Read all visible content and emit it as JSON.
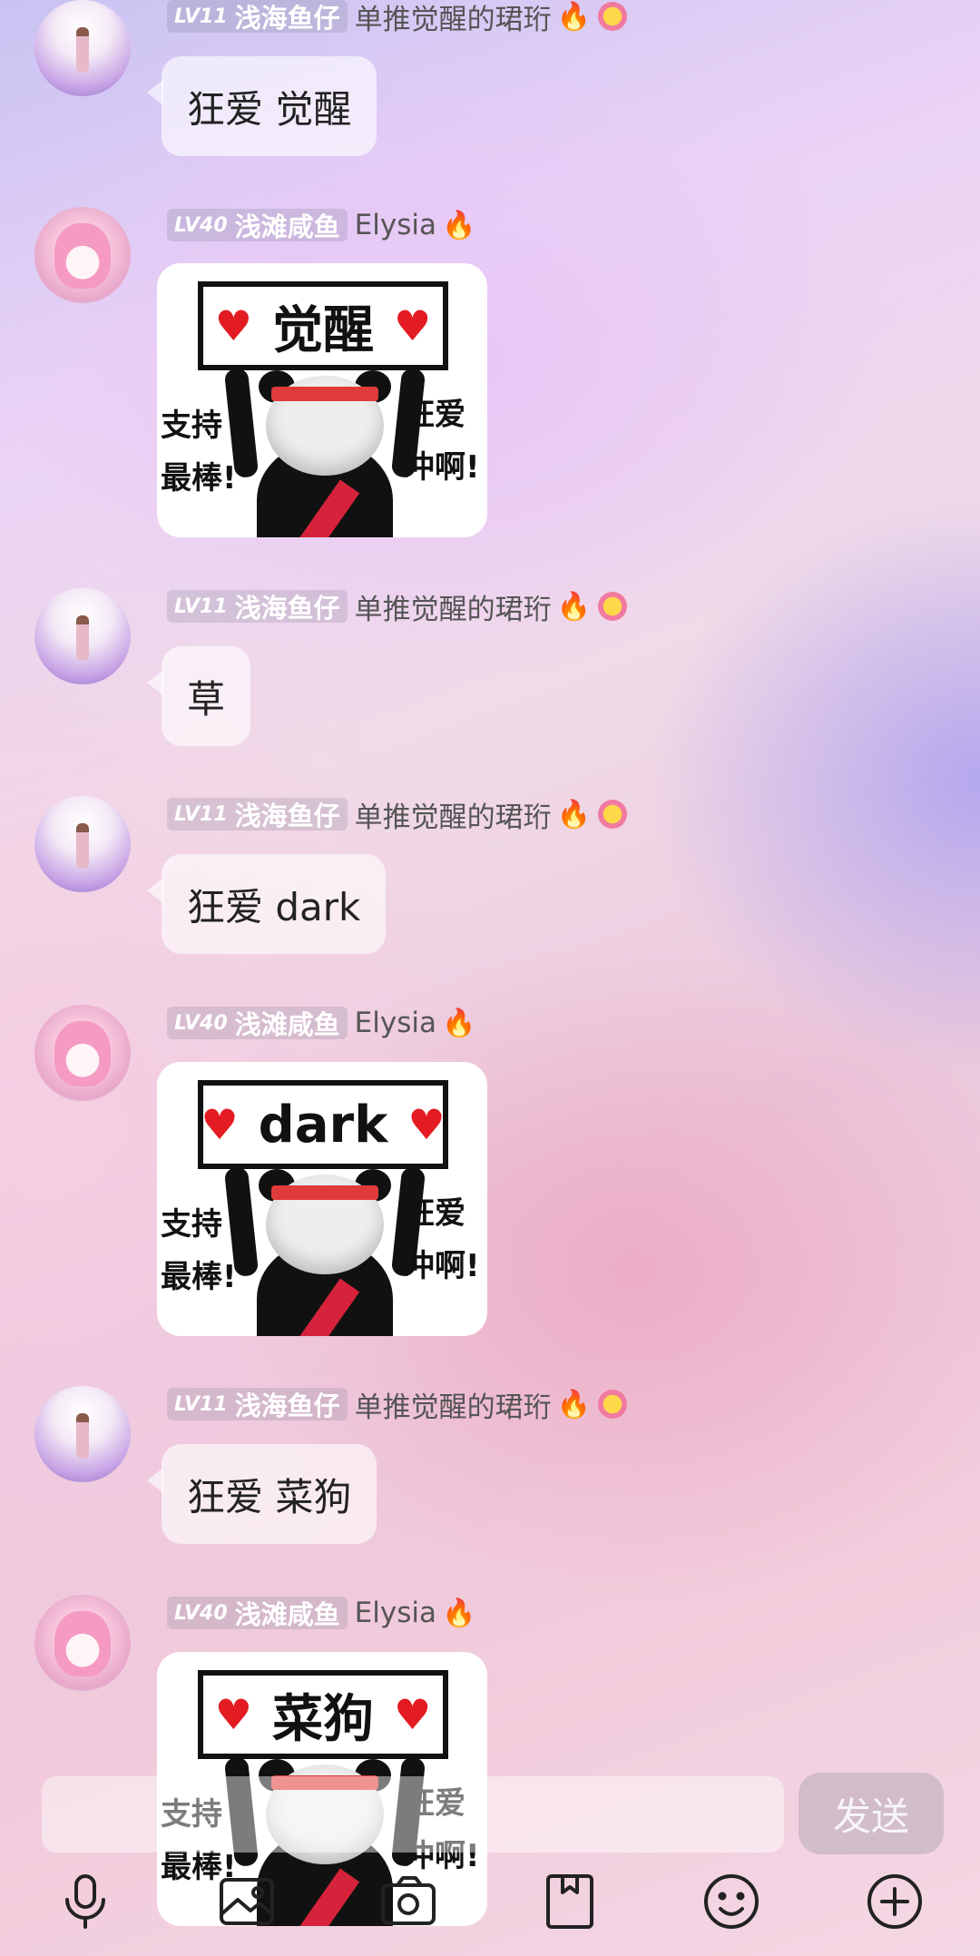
{
  "messages": [
    {
      "level": "LV11",
      "group": "浅海鱼仔",
      "nick": "单推觉醒的珺珩",
      "type": "text",
      "text": "狂爱 觉醒"
    },
    {
      "level": "LV40",
      "group": "浅滩咸鱼",
      "nick": "Elysia",
      "type": "sticker",
      "sign": "觉醒",
      "left_text": "支持 最棒!",
      "right_text": "狂爱 冲啊!"
    },
    {
      "level": "LV11",
      "group": "浅海鱼仔",
      "nick": "单推觉醒的珺珩",
      "type": "text",
      "text": "草"
    },
    {
      "level": "LV11",
      "group": "浅海鱼仔",
      "nick": "单推觉醒的珺珩",
      "type": "text",
      "text": "狂爱 dark"
    },
    {
      "level": "LV40",
      "group": "浅滩咸鱼",
      "nick": "Elysia",
      "type": "sticker",
      "sign": "dark",
      "left_text": "支持 最棒!",
      "right_text": "狂爱 冲啊!"
    },
    {
      "level": "LV11",
      "group": "浅海鱼仔",
      "nick": "单推觉醒的珺珩",
      "type": "text",
      "text": "狂爱 菜狗"
    },
    {
      "level": "LV40",
      "group": "浅滩咸鱼",
      "nick": "Elysia",
      "type": "sticker",
      "sign": "菜狗",
      "left_text": "支持 最棒!",
      "right_text": "狂爱 冲啊!"
    }
  ],
  "composer": {
    "input_value": "",
    "send_label": "发送"
  },
  "toolbar": {
    "icons": [
      "microphone-icon",
      "image-icon",
      "camera-icon",
      "file-icon",
      "emoji-icon",
      "plus-icon"
    ]
  },
  "colors": {
    "badge_bg": "#9a98ab",
    "heart": "#e31b23",
    "fire": "#ff5a1f"
  }
}
